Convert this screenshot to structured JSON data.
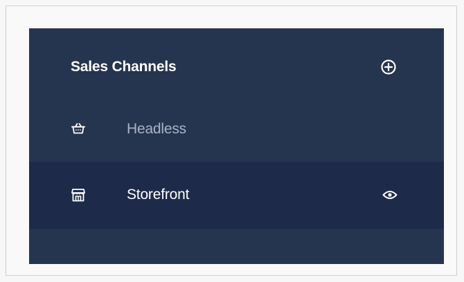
{
  "sidebar": {
    "section_title": "Sales Channels",
    "add_icon": "plus-circle-icon",
    "items": [
      {
        "label": "Headless",
        "icon": "basket-icon",
        "active": false
      },
      {
        "label": "Storefront",
        "icon": "storefront-icon",
        "active": true,
        "action_icon": "eye-icon"
      }
    ]
  },
  "colors": {
    "panel_bg": "#26354f",
    "active_row_bg": "#1d2a4a",
    "text_primary": "#ffffff",
    "text_muted": "#a8b3c6"
  }
}
